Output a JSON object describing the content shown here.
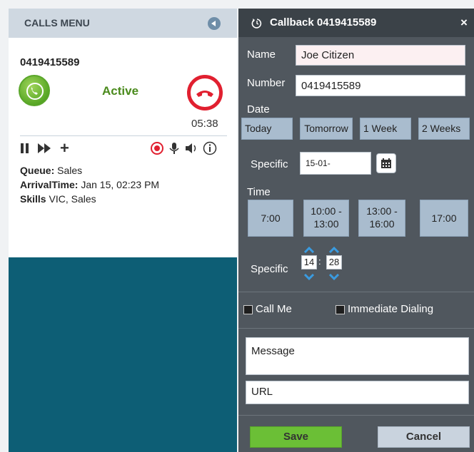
{
  "calls_menu": {
    "title": "CALLS MENU"
  },
  "call": {
    "number": "0419415589",
    "status": "Active",
    "timer": "05:38",
    "queue_label": "Queue:",
    "queue_value": "Sales",
    "arrival_label": "ArrivalTime:",
    "arrival_value": "Jan 15, 02:23 PM",
    "skills_label": "Skills",
    "skills_value": "VIC, Sales",
    "icons": [
      "answer-icon",
      "hangup-icon",
      "pause-icon",
      "fast-forward-icon",
      "add-icon",
      "record-icon",
      "microphone-icon",
      "speaker-icon",
      "info-icon"
    ]
  },
  "callback": {
    "title": "Callback 0419415589",
    "close": "×",
    "name_label": "Name",
    "name_value": "Joe Citizen",
    "number_label": "Number",
    "number_value": "0419415589",
    "date_label": "Date",
    "date_options": [
      "Today",
      "Tomorrow",
      "1 Week",
      "2 Weeks"
    ],
    "date_specific_label": "Specific",
    "date_specific_value": "15-01-",
    "time_label": "Time",
    "time_options": [
      "7:00",
      "10:00 -",
      "13:00",
      "13:00 -",
      "16:00",
      "17:00"
    ],
    "time_specific_label": "Specific",
    "hour": "14",
    "minute": "28",
    "call_me_label": "Call Me",
    "immediate_label": "Immediate Dialing",
    "message_placeholder": "Message",
    "url_placeholder": "URL",
    "save_label": "Save",
    "cancel_label": "Cancel"
  },
  "colors": {
    "panel_dark": "#50575e",
    "header_dark": "#3b4248",
    "teal_background": "#0d5e75",
    "active_green": "#4a8a1c",
    "hangup_red": "#e12030",
    "save_green": "#6bbf36",
    "option_blue": "#a9bcce"
  }
}
